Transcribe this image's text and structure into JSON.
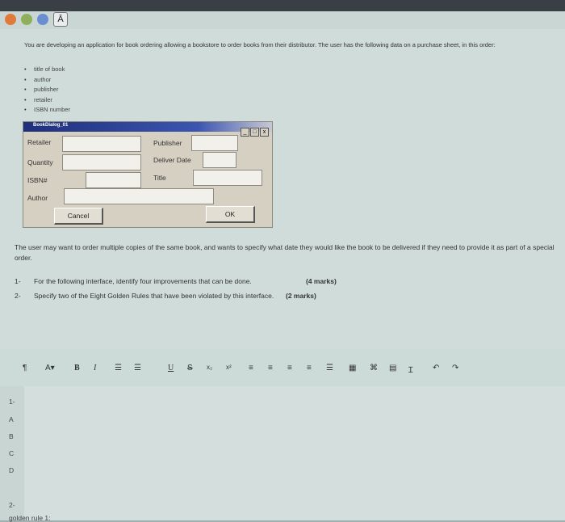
{
  "intro": {
    "text": "You are developing an application for book ordering allowing a bookstore to order books from their distributor. The user has the following data on a purchase sheet, in this order:",
    "bullets": [
      "title of book",
      "author",
      "publisher",
      "retailer",
      "ISBN number"
    ]
  },
  "dialog": {
    "title": "BookDialog_01",
    "labels": {
      "retailer": "Retailer",
      "quantity": "Quantity",
      "isbn": "ISBN#",
      "author": "Author",
      "publisher": "Publisher",
      "deliver_date": "Deliver Date",
      "title": "Title"
    },
    "buttons": {
      "cancel": "Cancel",
      "ok": "OK"
    },
    "window_controls": {
      "minimize": "_",
      "maximize": "□",
      "close": "x"
    }
  },
  "scenario": "The user may want to order multiple copies of the same book, and wants to specify what date they would like the book to be delivered if they need to provide it as part of a special order.",
  "questions": [
    {
      "num": "1-",
      "text": "For the following interface, identify four improvements that can be done.",
      "marks": "(4 marks)"
    },
    {
      "num": "2-",
      "text": "Specify two of the Eight Golden Rules that have been violated by this interface.",
      "marks": "(2 marks)"
    }
  ],
  "toolbar": {
    "para": "¶",
    "font_color": "A▾",
    "bold": "B",
    "italic": "I",
    "underline": "U",
    "strike": "S",
    "subscript": "x₂",
    "superscript": "x²"
  },
  "answer_lines": [
    "1-",
    "A",
    "B",
    "C",
    "D",
    "2-",
    "golden rule 1:"
  ]
}
